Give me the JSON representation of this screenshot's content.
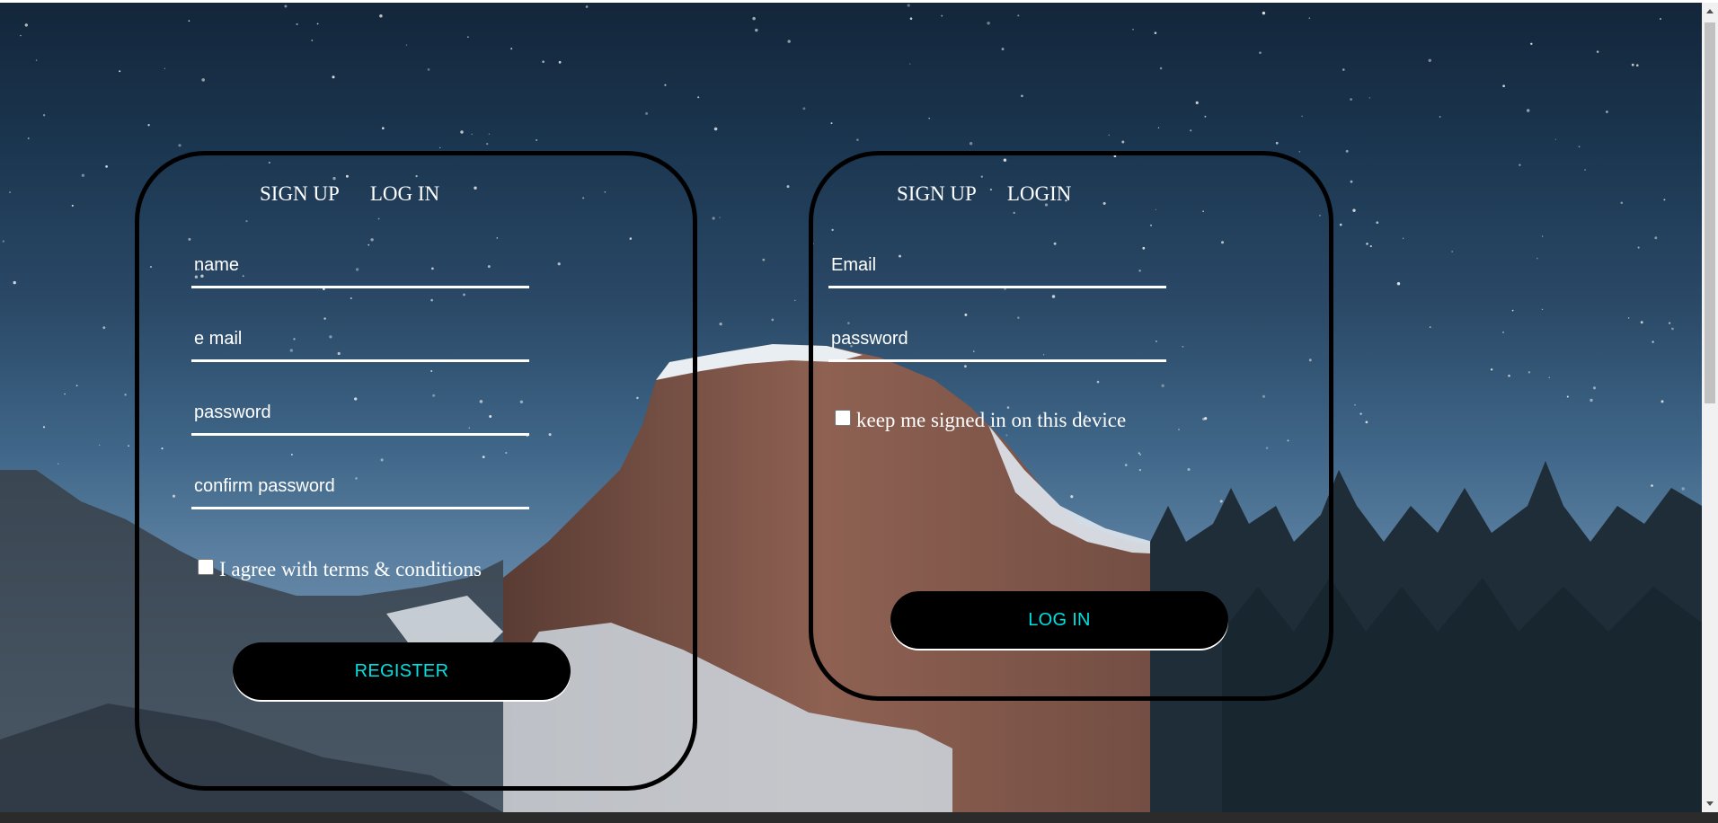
{
  "signup_card": {
    "tabs": [
      "SIGN UP",
      "LOG IN"
    ],
    "fields": {
      "name_placeholder": "name",
      "email_placeholder": "e mail",
      "password_placeholder": "password",
      "confirm_placeholder": "confirm password"
    },
    "terms_label": "I agree with terms & conditions",
    "register_label": "REGISTER"
  },
  "login_card": {
    "tabs": [
      "SIGN UP",
      "LOGIN"
    ],
    "fields": {
      "email_placeholder": "Email",
      "password_placeholder": "password"
    },
    "keep_signed_in_label": "keep me signed in on this device",
    "login_label": "LOG IN"
  },
  "colors": {
    "text": "#ffffff",
    "button_bg": "#000000",
    "button_text": "#00e0e0",
    "card_border": "#000000"
  }
}
